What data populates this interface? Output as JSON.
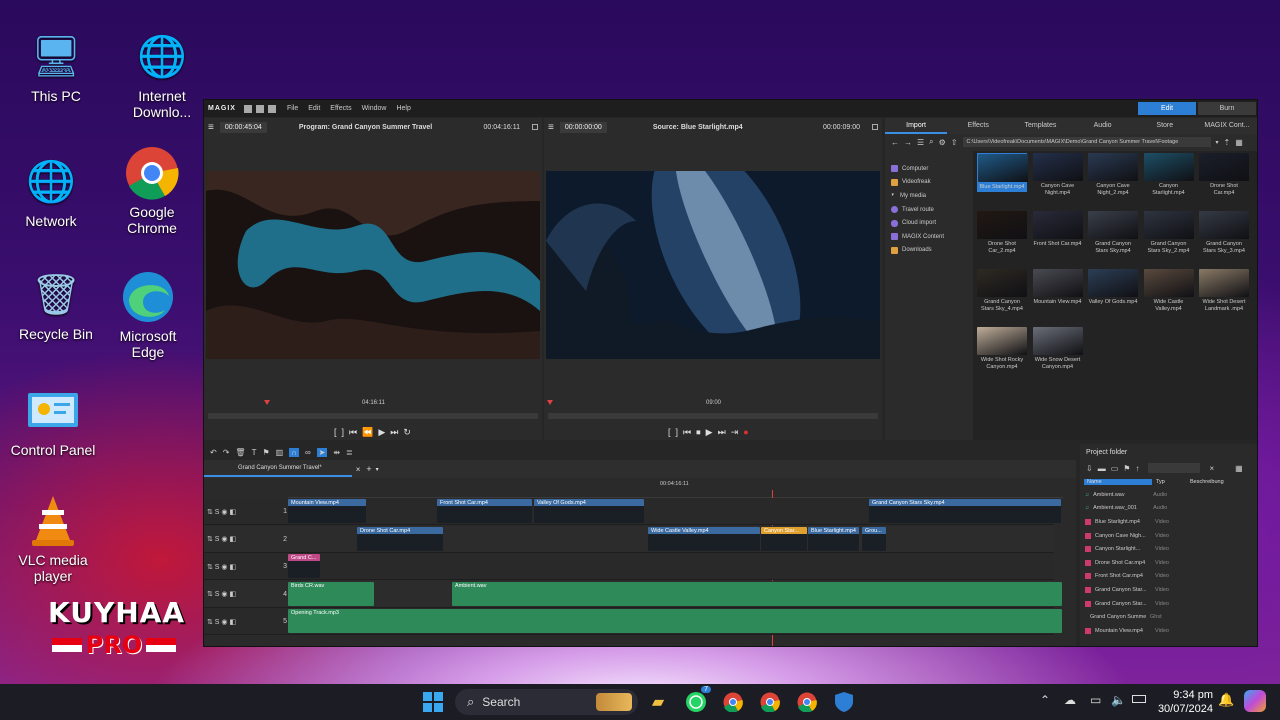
{
  "desktop": {
    "icons": [
      {
        "label": "This PC",
        "glyph": "🖥"
      },
      {
        "label": "Internet Downlo...",
        "glyph": "🌐"
      },
      {
        "label": "Network",
        "glyph": "🌐"
      },
      {
        "label": "Google Chrome",
        "glyph": "◉"
      },
      {
        "label": "Recycle Bin",
        "glyph": "♻"
      },
      {
        "label": "Microsoft Edge",
        "glyph": "◐"
      },
      {
        "label": "Control Panel",
        "glyph": "🗔"
      },
      {
        "label": "VLC media player",
        "glyph": "▲"
      }
    ],
    "watermark": {
      "line1": "KUYHAA",
      "line2": "PRO"
    }
  },
  "app": {
    "brand": "MAGIX",
    "menu": [
      "File",
      "Edit",
      "Effects",
      "Window",
      "Help"
    ],
    "modes": [
      "Edit",
      "Burn"
    ]
  },
  "program_monitor": {
    "timecode_left": "00:00:45:04",
    "title": "Program: Grand Canyon Summer Travel",
    "timecode_right": "00:04:16:11",
    "scrub_label": "04:16:11"
  },
  "source_monitor": {
    "timecode_left": "00:00:00:00",
    "title": "Source: Blue Starlight.mp4",
    "timecode_right": "00:00:09:00",
    "scrub_label": "09:00"
  },
  "media_pool": {
    "tabs": [
      "Import",
      "Effects",
      "Templates",
      "Audio",
      "Store",
      "MAGIX Cont..."
    ],
    "path": "C:\\Users\\Videofreak\\Documents\\MAGIX\\Demo\\Grand Canyon Summer Travel\\Footage",
    "tree": [
      {
        "label": "Computer",
        "color": "#8a6fd8"
      },
      {
        "label": "Videofreak",
        "color": "#e0a040"
      },
      {
        "label": "My media",
        "color": "#888"
      },
      {
        "label": "Travel route",
        "color": "#8a6fd8"
      },
      {
        "label": "Cloud import",
        "color": "#8a6fd8"
      },
      {
        "label": "MAGIX Content",
        "color": "#8a6fd8"
      },
      {
        "label": "Downloads",
        "color": "#e0a040"
      }
    ],
    "thumbs": [
      {
        "label": "Blue Starlight.mp4",
        "color": "#1f5a88"
      },
      {
        "label": "Canyon Cave Night.mp4",
        "color": "#23304a"
      },
      {
        "label": "Canyon Cave Night_2.mp4",
        "color": "#2a3a52"
      },
      {
        "label": "Canyon Starlight.mp4",
        "color": "#1d4f66"
      },
      {
        "label": "Drone Shot Car.mp4",
        "color": "#1a1f2a"
      },
      {
        "label": "Drone Shot Car_2.mp4",
        "color": "#221812"
      },
      {
        "label": "Front Shot Car.mp4",
        "color": "#2a2a3a"
      },
      {
        "label": "Grand Canyon Stars Sky.mp4",
        "color": "#3a3f4a"
      },
      {
        "label": "Grand Canyon Stars Sky_2.mp4",
        "color": "#2e3440"
      },
      {
        "label": "Grand Canyon Stars Sky_3.mp4",
        "color": "#353a45"
      },
      {
        "label": "Grand Canyon Stars Sky_4.mp4",
        "color": "#2e2a22"
      },
      {
        "label": "Mountain View.mp4",
        "color": "#4a4a52"
      },
      {
        "label": "Valley Of Gods.mp4",
        "color": "#2c3e55"
      },
      {
        "label": "Wide Castle Valley.mp4",
        "color": "#5a4a3e"
      },
      {
        "label": "Wide Shot Desert Landmark .mp4",
        "color": "#8a7a66"
      },
      {
        "label": "Wide Shot Rocky Canyon.mp4",
        "color": "#bfae9a"
      },
      {
        "label": "Wide Snow Desert Canyon.mp4",
        "color": "#6a6e78"
      }
    ]
  },
  "timeline": {
    "project_tab": "Grand Canyon Summer Travel*",
    "ruler_center": "00:04:16:11",
    "tracks": [
      {
        "num": "1",
        "clips": [
          {
            "label": "Mountain View.mp4",
            "color": "#3a6aa0"
          },
          {
            "label": "Front Shot Car.mp4",
            "color": "#3a6aa0"
          },
          {
            "label": "Valley Of Gods.mp4",
            "color": "#3a6aa0"
          },
          {
            "label": "Grand Canyon Stars Sky.mp4",
            "color": "#3a6aa0"
          }
        ]
      },
      {
        "num": "2",
        "clips": [
          {
            "label": "Drone Shot Car.mp4",
            "color": "#3a6aa0"
          },
          {
            "label": "Wide Castle Valley.mp4",
            "color": "#3a6aa0"
          },
          {
            "label": "Canyon Star...",
            "color": "#e0a030"
          },
          {
            "label": "Blue Starlight.mp4",
            "color": "#3a6aa0"
          },
          {
            "label": "Grou...",
            "color": "#3a6aa0"
          }
        ]
      },
      {
        "num": "3",
        "clips": [
          {
            "label": "Grand C...",
            "color": "#c04a88"
          }
        ]
      },
      {
        "num": "4",
        "clips": [
          {
            "label": "Birds CR.wav",
            "color": "#2f8a5a"
          },
          {
            "label": "Ambient.wav",
            "color": "#2f8a5a"
          }
        ]
      },
      {
        "num": "5",
        "clips": [
          {
            "label": "Opening Track.mp3",
            "color": "#2f8a5a"
          }
        ]
      }
    ]
  },
  "project_folder": {
    "title": "Project folder",
    "columns": [
      "Name",
      "Typ",
      "Beschreibung"
    ],
    "rows": [
      {
        "name": "Ambient.wav",
        "type": "Audio",
        "kind": "audio"
      },
      {
        "name": "Ambient.wav_001",
        "type": "Audio",
        "kind": "audio"
      },
      {
        "name": "Blue Starlight.mp4",
        "type": "Video",
        "kind": "video"
      },
      {
        "name": "Canyon Cave Nigh...",
        "type": "Video",
        "kind": "video"
      },
      {
        "name": "Canyon Starlight...",
        "type": "Video",
        "kind": "video"
      },
      {
        "name": "Drone Shot Car.mp4",
        "type": "Video",
        "kind": "video"
      },
      {
        "name": "Front Shot Car.mp4",
        "type": "Video",
        "kind": "video"
      },
      {
        "name": "Grand Canyon Star...",
        "type": "Video",
        "kind": "video"
      },
      {
        "name": "Grand Canyon Star...",
        "type": "Video",
        "kind": "video"
      },
      {
        "name": "Grand Canyon Summer ...",
        "type": "Ghst",
        "kind": "none"
      },
      {
        "name": "Mountain View.mp4",
        "type": "Video",
        "kind": "video"
      }
    ]
  },
  "taskbar": {
    "search": "Search",
    "time": "9:34 pm",
    "date": "30/07/2024",
    "badges": {
      "whatsapp": "7"
    }
  }
}
